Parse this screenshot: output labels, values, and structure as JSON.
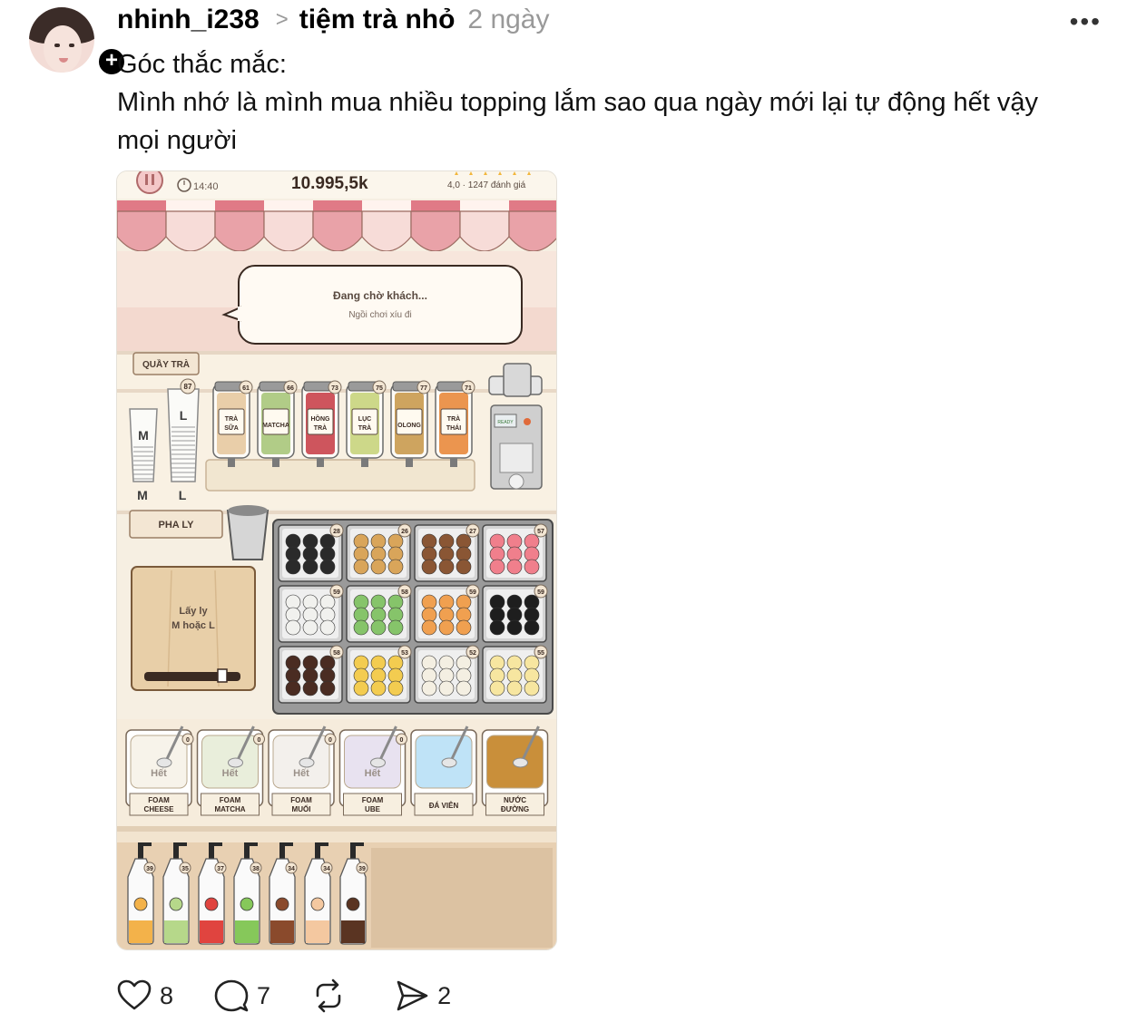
{
  "post": {
    "author": "nhinh_i238",
    "separator": ">",
    "community": "tiệm trà nhỏ",
    "time": "2 ngày",
    "more_label": "•••",
    "follow_label": "+",
    "text_line1": "Góc thắc mắc:",
    "text_line2": "Mình nhớ là mình mua nhiều topping lắm sao qua ngày mới lại tự động hết vậy",
    "text_line3": "mọi người"
  },
  "game": {
    "time": "14:40",
    "money": "10.995,5k",
    "rating": "4,0 · 1247 đánh giá",
    "waiting_title": "Đang chờ khách...",
    "waiting_sub": "Ngồi chơi xíu đi",
    "counter_label": "QUẦY TRÀ",
    "prep_label": "PHA LY",
    "cup_prompt_line1": "Lấy ly",
    "cup_prompt_line2": "M hoặc L",
    "cup_sizes": [
      "M",
      "L"
    ],
    "cup_count_l": "87",
    "ready_label": "READY",
    "teas": [
      {
        "label1": "TRÀ",
        "label2": "SỮA",
        "count": "61",
        "color": "#e7c9a0"
      },
      {
        "label1": "MATCHA",
        "label2": "",
        "count": "66",
        "color": "#a9c77a"
      },
      {
        "label1": "HỒNG",
        "label2": "TRÀ",
        "count": "73",
        "color": "#c9434b"
      },
      {
        "label1": "LỤC",
        "label2": "TRÀ",
        "count": "75",
        "color": "#c8d47c"
      },
      {
        "label1": "OLONG",
        "label2": "",
        "count": "77",
        "color": "#c99a4e"
      },
      {
        "label1": "TRÀ",
        "label2": "THÁI",
        "count": "71",
        "color": "#e98a3c"
      }
    ],
    "toppings": [
      {
        "count": "28",
        "color": "#2a2a2a"
      },
      {
        "count": "26",
        "color": "#d9a55a"
      },
      {
        "count": "27",
        "color": "#8a5634"
      },
      {
        "count": "57",
        "color": "#f07f8c"
      },
      {
        "count": "59",
        "color": "#f1f1ee"
      },
      {
        "count": "58",
        "color": "#86c46a"
      },
      {
        "count": "59",
        "color": "#f0a050"
      },
      {
        "count": "59",
        "color": "#1e1e1e"
      },
      {
        "count": "58",
        "color": "#4a2c22"
      },
      {
        "count": "53",
        "color": "#f3cc50"
      },
      {
        "count": "52",
        "color": "#f4efe2"
      },
      {
        "count": "55",
        "color": "#f7e6a0"
      }
    ],
    "foams": [
      {
        "status": "Hết",
        "label1": "FOAM",
        "label2": "CHEESE",
        "count": "0",
        "color": "#f7f3ea"
      },
      {
        "status": "Hết",
        "label1": "FOAM",
        "label2": "MATCHA",
        "count": "0",
        "color": "#e9eedb"
      },
      {
        "status": "Hết",
        "label1": "FOAM",
        "label2": "MUỐI",
        "count": "0",
        "color": "#f3f0ec"
      },
      {
        "status": "Hết",
        "label1": "FOAM",
        "label2": "UBE",
        "count": "0",
        "color": "#e8e2f0"
      },
      {
        "status": "",
        "label1": "ĐÁ VIÊN",
        "label2": "",
        "count": "",
        "color": "#bfe3f7"
      },
      {
        "status": "",
        "label1": "NƯỚC",
        "label2": "ĐƯỜNG",
        "count": "",
        "color": "#c98f3a"
      }
    ],
    "syrups": [
      {
        "count": "39",
        "color": "#f3b24a"
      },
      {
        "count": "35",
        "color": "#b6d88a"
      },
      {
        "count": "37",
        "color": "#e0443f"
      },
      {
        "count": "38",
        "color": "#86c85a"
      },
      {
        "count": "34",
        "color": "#8a4a2c"
      },
      {
        "count": "34",
        "color": "#f4c8a0"
      },
      {
        "count": "39",
        "color": "#5a3422"
      }
    ]
  },
  "actions": {
    "likes": "8",
    "comments": "7",
    "reposts": "",
    "shares": "2"
  }
}
